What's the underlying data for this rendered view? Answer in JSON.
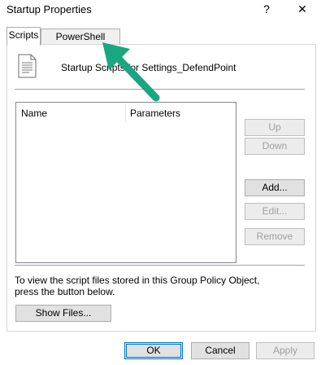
{
  "window": {
    "title": "Startup Properties",
    "help_glyph": "?",
    "close_glyph": "✕"
  },
  "tabs": [
    {
      "label": "Scripts",
      "active": true
    },
    {
      "label": "PowerShell Scripts",
      "active": false
    }
  ],
  "header": {
    "icon": "script-file-icon",
    "text": "Startup Scripts for Settings_DefendPoint"
  },
  "list": {
    "columns": [
      "Name",
      "Parameters"
    ],
    "rows": []
  },
  "side_buttons": {
    "up": "Up",
    "down": "Down",
    "add": "Add...",
    "edit": "Edit...",
    "remove": "Remove"
  },
  "info": {
    "text": "To view the script files stored in this Group Policy Object, press the button below.",
    "show_files": "Show Files..."
  },
  "footer": {
    "ok": "OK",
    "cancel": "Cancel",
    "apply": "Apply"
  },
  "annotation": {
    "arrow_color": "#1aa67f",
    "icon": "arrow-icon"
  }
}
